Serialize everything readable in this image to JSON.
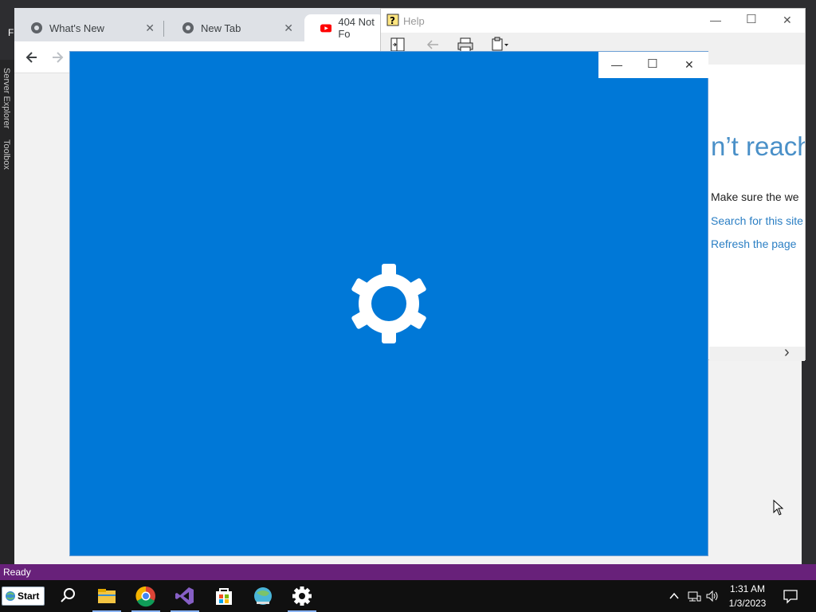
{
  "vs": {
    "menu_first": "F",
    "side_tabs": [
      "Server Explorer",
      "Toolbox"
    ],
    "status": "Ready"
  },
  "chrome": {
    "tabs": [
      {
        "title": "What's New",
        "close": "✕"
      },
      {
        "title": "New Tab",
        "close": "✕"
      },
      {
        "title": "404 Not Fo"
      }
    ],
    "page": {
      "heading": "n’t reach",
      "line1": "Make sure the we",
      "link1": "Search for this site",
      "link2": "Refresh the page"
    }
  },
  "help": {
    "title": "Help",
    "minimize": "—",
    "maximize": "☐",
    "close": "✕",
    "scroll_arrow": "›"
  },
  "splash": {
    "minimize": "—",
    "maximize": "☐",
    "close": "✕"
  },
  "taskbar": {
    "start_label": "Start",
    "time": "1:31 AM",
    "date": "1/3/2023"
  },
  "colors": {
    "splash_bg": "#0078d7",
    "status_bar": "#68217a",
    "link": "#2b7fc4"
  }
}
